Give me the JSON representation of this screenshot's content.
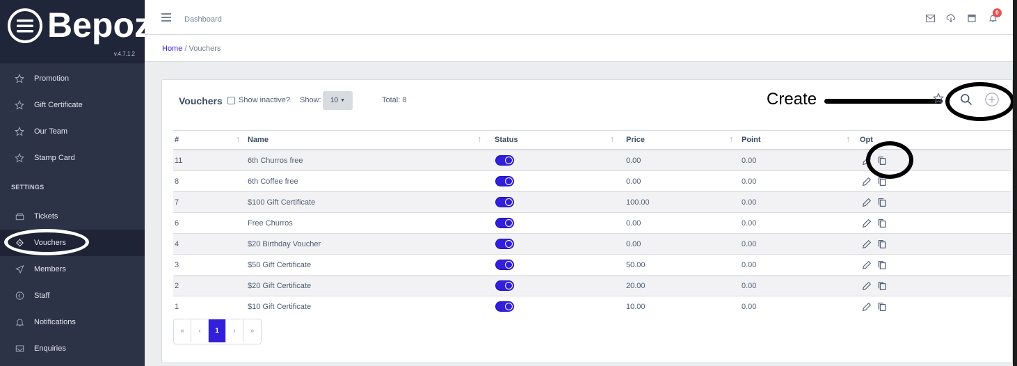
{
  "brand": {
    "name": "Bepoz",
    "version": "v.4.7.1.2"
  },
  "sidebar": {
    "items": [
      {
        "label": "Promotion",
        "icon": "star-icon"
      },
      {
        "label": "Gift Certificate",
        "icon": "star-icon"
      },
      {
        "label": "Our Team",
        "icon": "star-icon"
      },
      {
        "label": "Stamp Card",
        "icon": "star-icon"
      }
    ],
    "section_title": "SETTINGS",
    "settings_items": [
      {
        "label": "Tickets",
        "icon": "ticket-icon"
      },
      {
        "label": "Vouchers",
        "icon": "voucher-icon",
        "active": true
      },
      {
        "label": "Members",
        "icon": "send-icon"
      },
      {
        "label": "Staff",
        "icon": "clock-icon"
      },
      {
        "label": "Notifications",
        "icon": "bell-icon"
      },
      {
        "label": "Enquiries",
        "icon": "inbox-icon"
      }
    ]
  },
  "header": {
    "title": "Dashboard",
    "notification_count": "0"
  },
  "breadcrumb": {
    "home": "Home",
    "separator": "/",
    "current": "Vouchers"
  },
  "card": {
    "title": "Vouchers",
    "show_inactive_label": "Show inactive?",
    "show_label": "Show:",
    "show_value": "10",
    "total_label": "Total: 8",
    "annotation_create": "Create"
  },
  "table": {
    "columns": [
      "#",
      "Name",
      "Status",
      "Price",
      "Point",
      "Opt"
    ],
    "rows": [
      {
        "id": "11",
        "name": "6th Churros free",
        "price": "0.00",
        "point": "0.00"
      },
      {
        "id": "8",
        "name": "6th Coffee free",
        "price": "0.00",
        "point": "0.00"
      },
      {
        "id": "7",
        "name": "$100 Gift Certificate",
        "price": "100.00",
        "point": "0.00"
      },
      {
        "id": "6",
        "name": "Free Churros",
        "price": "0.00",
        "point": "0.00"
      },
      {
        "id": "4",
        "name": "$20 Birthday Voucher",
        "price": "0.00",
        "point": "0.00"
      },
      {
        "id": "3",
        "name": "$50 Gift Certificate",
        "price": "50.00",
        "point": "0.00"
      },
      {
        "id": "2",
        "name": "$20 Gift Certificate",
        "price": "20.00",
        "point": "0.00"
      },
      {
        "id": "1",
        "name": "$10 Gift Certificate",
        "price": "10.00",
        "point": "0.00"
      }
    ]
  },
  "pagination": {
    "first": "«",
    "prev": "‹",
    "current": "1",
    "next": "›",
    "last": "»"
  },
  "colors": {
    "primary": "#321fdb",
    "sidebar": "#2c3347",
    "danger": "#e55353"
  }
}
